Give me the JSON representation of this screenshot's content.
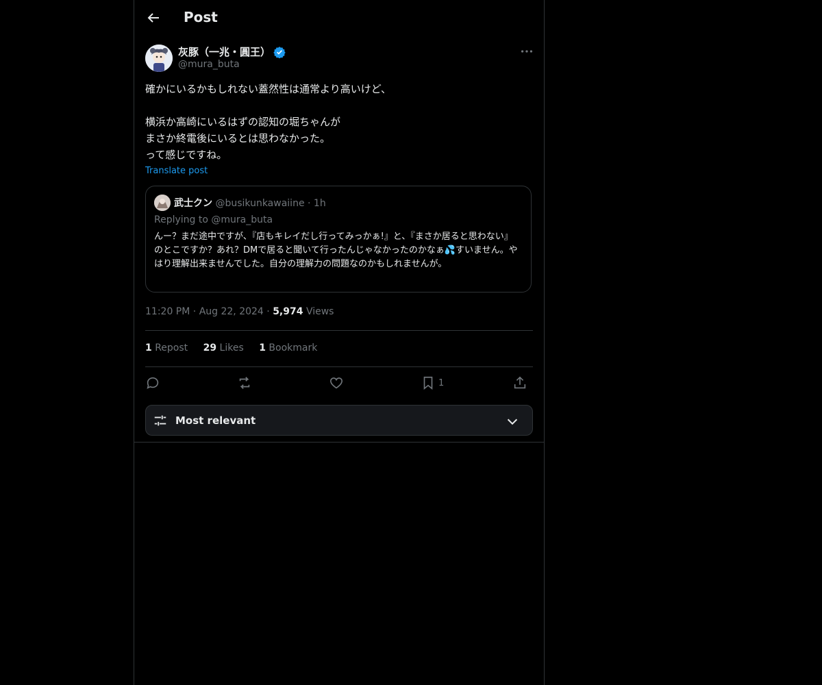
{
  "header": {
    "title": "Post"
  },
  "post": {
    "author_name": "灰豚（一兆・圓王）",
    "handle": "@mura_buta",
    "text": "確かにいるかもしれない蓋然性は通常より高いけど、\n\n横浜か高崎にいるはずの認知の堀ちゃんが\nまさか終電後にいるとは思わなかった。\nって感じですね。",
    "translate_label": "Translate post"
  },
  "quote": {
    "author_name": "武士クン",
    "handle": "@busikunkawaiine",
    "separator": "·",
    "time": "1h",
    "replying_to": "Replying to @mura_buta",
    "text": "んー？まだ途中ですが、『店もキレイだし行ってみっかぁ!』と、『まさか居ると思わない』のとこですか？あれ？DMで居ると聞いて行ったんじゃなかったのかなぁ💦すいません。やはり理解出来ませんでした。自分の理解力の問題なのかもしれませんが。"
  },
  "meta": {
    "time": "11:20 PM",
    "date": "Aug 22, 2024",
    "views_count": "5,974",
    "views_label": "Views",
    "sep": "·"
  },
  "stats": {
    "reposts_count": "1",
    "reposts_label": "Repost",
    "likes_count": "29",
    "likes_label": "Likes",
    "bookmarks_count": "1",
    "bookmarks_label": "Bookmark"
  },
  "actions": {
    "bookmark_count": "1"
  },
  "sort": {
    "label": "Most relevant"
  },
  "colors": {
    "accent": "#1d9bf0",
    "background": "#000000",
    "border": "#2f3336",
    "muted": "#71767b"
  },
  "icons": [
    "back-arrow-icon",
    "verified-badge-icon",
    "more-icon",
    "reply-icon",
    "repost-icon",
    "like-icon",
    "bookmark-icon",
    "share-icon",
    "sliders-icon",
    "chevron-down-icon"
  ]
}
